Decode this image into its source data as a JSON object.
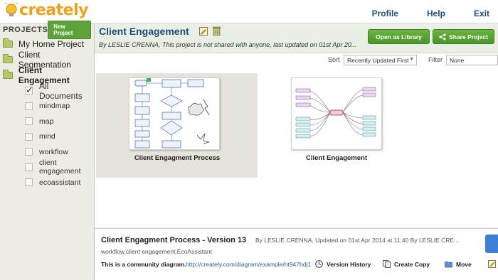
{
  "app": {
    "logo_text": "creately",
    "nav": [
      "Profile",
      "Help",
      "Exit"
    ]
  },
  "sidebar": {
    "title": "PROJECTS",
    "new_project_label": "New Project",
    "projects": [
      {
        "label": "My Home Project",
        "active": false
      },
      {
        "label": "Client Segmentation",
        "active": false
      },
      {
        "label": "Client Engagement",
        "active": true
      }
    ],
    "tags": [
      {
        "label": "All Documents",
        "checked": true
      },
      {
        "label": "mindmap",
        "checked": false
      },
      {
        "label": "map",
        "checked": false
      },
      {
        "label": "mind",
        "checked": false
      },
      {
        "label": "workflow",
        "checked": false
      },
      {
        "label": "client engagement",
        "checked": false
      },
      {
        "label": "ecoassistant",
        "checked": false
      }
    ]
  },
  "header": {
    "title": "Client Engagement",
    "subtitle": "By LESLIE CRENNA, This project is not shared with anyone, last updated on 01st Apr 20...",
    "open_library_label": "Open as Library",
    "share_label": "Share Project",
    "edit_icon": "pencil-icon",
    "delete_icon": "trash-icon"
  },
  "sortbar": {
    "sort_label": "Sort",
    "sort_value": "Recently Updated First",
    "filter_label": "Filter",
    "filter_value": "None"
  },
  "documents": [
    {
      "title": "Client Engagment Process",
      "selected": true
    },
    {
      "title": "Client Engagement",
      "selected": false
    }
  ],
  "detail": {
    "title": "Client Engagment Process - Version 13",
    "by": "By LESLIE CRENNA, Updated on 01st Apr 2014 at 11:40 By LESLIE CRE...",
    "tags": "workflow,client engagement,EcoAssistant",
    "community": "This is a community diagram.",
    "link": "http://creately.com/diagram/example/ht947hdj1",
    "actions": [
      "Version History",
      "Create Copy",
      "Move"
    ]
  },
  "colors": {
    "brand": "#f0a11c",
    "nav_link": "#1e4c7c",
    "green_button": "#5ea339",
    "link": "#2a5da8"
  }
}
